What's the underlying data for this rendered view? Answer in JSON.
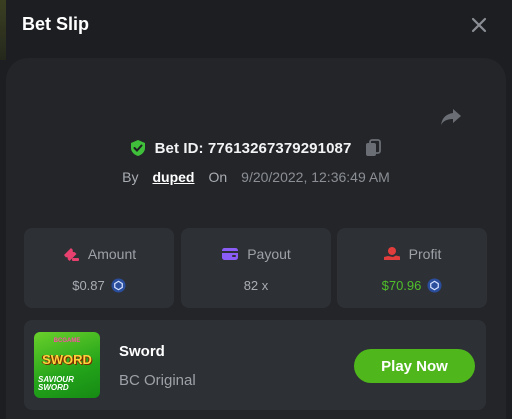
{
  "header": {
    "title": "Bet Slip"
  },
  "bet": {
    "id_label": "Bet ID: 7761326737929108​7",
    "by_label": "By",
    "user": "duped",
    "on_label": "On",
    "date": "9/20/2022, 12:36:49 AM"
  },
  "stats": {
    "amount": {
      "label": "Amount",
      "value": "$0.87"
    },
    "payout": {
      "label": "Payout",
      "value": "82 x"
    },
    "profit": {
      "label": "Profit",
      "value": "$70.96"
    }
  },
  "game": {
    "name": "Sword",
    "subtitle": "BC Original",
    "thumb_tag": "BCGAME",
    "thumb_logo": "SWORD",
    "thumb_caption": "SAVIOUR SWORD",
    "play_label": "Play Now"
  },
  "colors": {
    "accent_green": "#4fb71c",
    "profit_green": "#4fbf2a",
    "shield_green": "#3fbf3a",
    "amount_icon": "#e8416f",
    "payout_icon": "#8b5cf6",
    "profit_icon": "#e23d3d"
  },
  "icons": [
    "close-icon",
    "share-icon",
    "shield-check-icon",
    "copy-icon",
    "ticket-icon",
    "wallet-icon",
    "hand-coin-icon",
    "coin-icon"
  ]
}
